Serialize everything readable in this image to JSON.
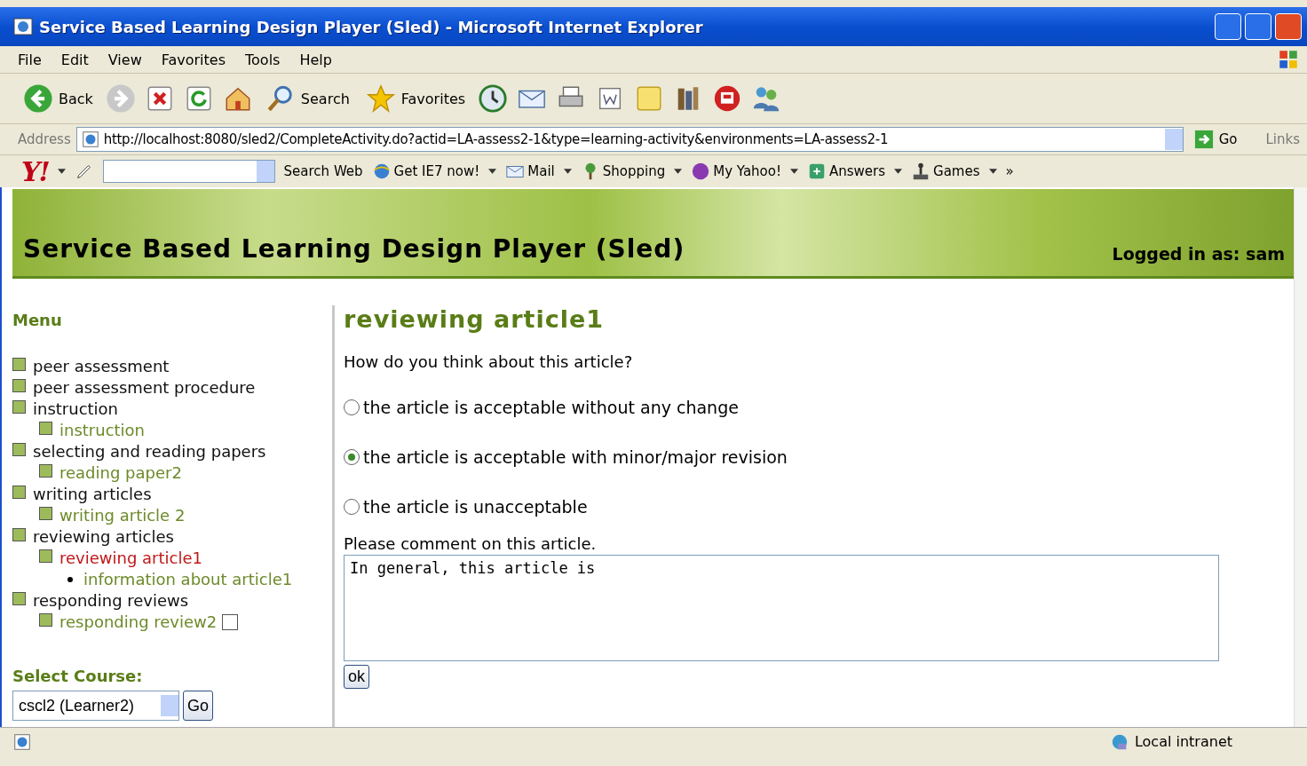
{
  "window": {
    "title": "Service Based Learning Design Player (Sled) - Microsoft Internet Explorer"
  },
  "menu_bar": [
    "File",
    "Edit",
    "View",
    "Favorites",
    "Tools",
    "Help"
  ],
  "toolbar": [
    {
      "kind": "back",
      "label": "Back"
    },
    {
      "kind": "forward"
    },
    {
      "kind": "stop"
    },
    {
      "kind": "refresh"
    },
    {
      "kind": "home"
    },
    {
      "kind": "search",
      "label": "Search"
    },
    {
      "kind": "favorites",
      "label": "Favorites"
    },
    {
      "kind": "history"
    },
    {
      "kind": "mail"
    },
    {
      "kind": "print"
    },
    {
      "kind": "edit"
    },
    {
      "kind": "note"
    },
    {
      "kind": "research"
    },
    {
      "kind": "messenger"
    },
    {
      "kind": "people"
    }
  ],
  "address": {
    "label": "Address",
    "url": "http://localhost:8080/sled2/CompleteActivity.do?actid=LA-assess2-1&type=learning-activity&environments=LA-assess2-1",
    "go": "Go",
    "links": "Links"
  },
  "yahoo_toolbar": {
    "logo": "Y!",
    "search": "Search Web",
    "items": [
      {
        "kind": "ie",
        "label": "Get IE7 now!"
      },
      {
        "kind": "mail",
        "label": "Mail"
      },
      {
        "kind": "shopping",
        "label": "Shopping"
      },
      {
        "kind": "myyahoo",
        "label": "My Yahoo!"
      },
      {
        "kind": "answers",
        "label": "Answers"
      },
      {
        "kind": "games",
        "label": "Games"
      }
    ],
    "more": "»"
  },
  "header": {
    "title": "Service Based Learning Design Player (Sled)",
    "user": "Logged in as: sam"
  },
  "sidebar": {
    "heading": "Menu",
    "items": [
      {
        "label": "peer assessment",
        "kind": "section",
        "selected": false
      },
      {
        "label": "peer assessment procedure",
        "kind": "section",
        "selected": false
      },
      {
        "label": "instruction",
        "kind": "section",
        "selected": false,
        "children": [
          {
            "label": "instruction",
            "kind": "activity",
            "selected": false
          }
        ]
      },
      {
        "label": "selecting and reading papers",
        "kind": "section",
        "selected": false,
        "children": [
          {
            "label": "reading paper2",
            "kind": "activity",
            "selected": false
          }
        ]
      },
      {
        "label": "writing articles",
        "kind": "section",
        "selected": false,
        "children": [
          {
            "label": "writing article 2",
            "kind": "activity",
            "selected": false
          }
        ]
      },
      {
        "label": "reviewing articles",
        "kind": "section",
        "selected": false,
        "children": [
          {
            "label": "reviewing article1",
            "kind": "activity",
            "selected": true,
            "children": [
              {
                "label": "information about article1",
                "kind": "resource",
                "selected": false
              }
            ]
          }
        ]
      },
      {
        "label": "responding reviews",
        "kind": "section",
        "selected": false,
        "children": [
          {
            "label": "responding review2",
            "kind": "activity",
            "selected": false,
            "checked": false
          }
        ]
      }
    ],
    "course_label": "Select Course:",
    "course": "cscl2 (Learner2)",
    "go": "Go"
  },
  "content": {
    "title": "reviewing article1",
    "question": "How do you think about this article?",
    "options": [
      {
        "label": "the article is acceptable without any change",
        "selected": false
      },
      {
        "label": "the article is acceptable with minor/major revision",
        "selected": true
      },
      {
        "label": "the article is unacceptable",
        "selected": false
      }
    ],
    "comment_label": "Please comment on this article.",
    "comment": "In general, this article is",
    "ok": "ok"
  },
  "status_bar": {
    "zone": "Local intranet"
  }
}
